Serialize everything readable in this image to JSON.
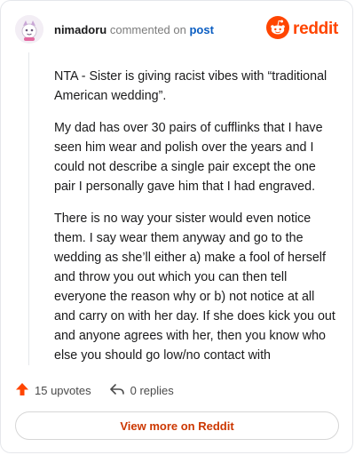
{
  "header": {
    "username": "nimadoru",
    "commented_on": "commented on",
    "post_link": "post",
    "brand_name": "reddit"
  },
  "comment": {
    "paragraphs": [
      "NTA - Sister is giving racist vibes with “traditional American wedding”.",
      "My dad has over 30 pairs of cufflinks that I have seen him wear and polish over the years and I could not describe a single pair except the one pair I personally gave him that I had engraved.",
      "There is no way your sister would even notice them. I say wear them anyway and go to the wedding as she’ll either a) make a fool of herself and throw you out which you can then tell everyone the reason why or b) not notice at all and carry on with her day. If she does kick you out and anyone agrees with her, then you know who else you should go low/no contact with"
    ]
  },
  "actions": {
    "upvotes": "15 upvotes",
    "replies": "0 replies"
  },
  "footer": {
    "view_more": "View more on Reddit"
  },
  "colors": {
    "brand": "#ff4500",
    "link": "#0a5dc2",
    "upvote": "#ff4500"
  },
  "icons": [
    "avatar",
    "reddit-logo-icon",
    "upvote-arrow-icon",
    "reply-arrow-icon"
  ]
}
